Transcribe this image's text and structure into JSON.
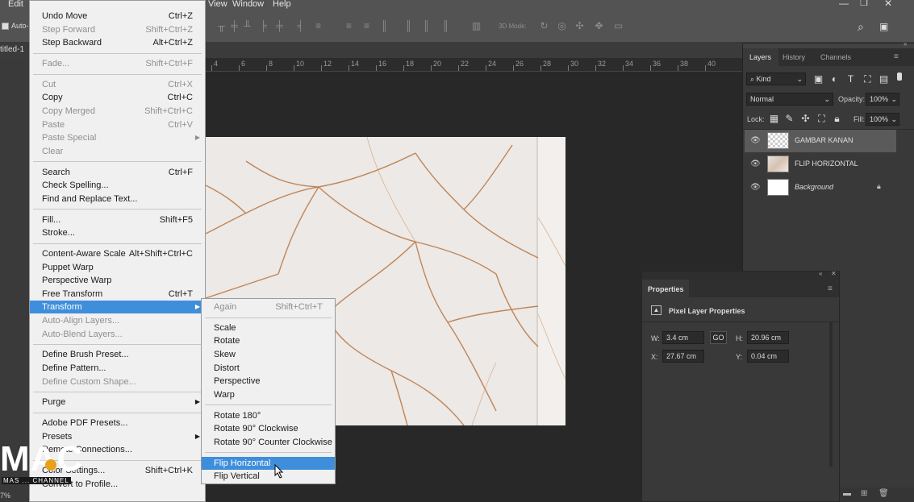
{
  "menubar": {
    "items": [
      "Edit",
      "View",
      "Window",
      "Help"
    ]
  },
  "optbar": {
    "auto_label": "Auto-",
    "mode_3d": "3D Mode:"
  },
  "doc_tab": {
    "title": "titled-1"
  },
  "ruler": {
    "ticks": [
      "4",
      "6",
      "8",
      "10",
      "12",
      "14",
      "16",
      "18",
      "20",
      "22",
      "24",
      "26",
      "28",
      "30",
      "32",
      "34",
      "36",
      "38",
      "40"
    ]
  },
  "edit_menu": {
    "items": [
      {
        "label": "Undo Move",
        "shortcut": "Ctrl+Z",
        "enabled": true
      },
      {
        "label": "Step Forward",
        "shortcut": "Shift+Ctrl+Z",
        "enabled": false
      },
      {
        "label": "Step Backward",
        "shortcut": "Alt+Ctrl+Z",
        "enabled": true
      },
      {
        "sep": true
      },
      {
        "label": "Fade...",
        "shortcut": "Shift+Ctrl+F",
        "enabled": false
      },
      {
        "sep": true
      },
      {
        "label": "Cut",
        "shortcut": "Ctrl+X",
        "enabled": false
      },
      {
        "label": "Copy",
        "shortcut": "Ctrl+C",
        "enabled": true
      },
      {
        "label": "Copy Merged",
        "shortcut": "Shift+Ctrl+C",
        "enabled": false
      },
      {
        "label": "Paste",
        "shortcut": "Ctrl+V",
        "enabled": false
      },
      {
        "label": "Paste Special",
        "shortcut": "",
        "enabled": false,
        "sub": true
      },
      {
        "label": "Clear",
        "shortcut": "",
        "enabled": false
      },
      {
        "sep": true
      },
      {
        "label": "Search",
        "shortcut": "Ctrl+F",
        "enabled": true
      },
      {
        "label": "Check Spelling...",
        "shortcut": "",
        "enabled": true
      },
      {
        "label": "Find and Replace Text...",
        "shortcut": "",
        "enabled": true
      },
      {
        "sep": true
      },
      {
        "label": "Fill...",
        "shortcut": "Shift+F5",
        "enabled": true
      },
      {
        "label": "Stroke...",
        "shortcut": "",
        "enabled": true
      },
      {
        "sep": true
      },
      {
        "label": "Content-Aware Scale",
        "shortcut": "Alt+Shift+Ctrl+C",
        "enabled": true
      },
      {
        "label": "Puppet Warp",
        "shortcut": "",
        "enabled": true
      },
      {
        "label": "Perspective Warp",
        "shortcut": "",
        "enabled": true
      },
      {
        "label": "Free Transform",
        "shortcut": "Ctrl+T",
        "enabled": true
      },
      {
        "label": "Transform",
        "shortcut": "",
        "enabled": true,
        "sub": true,
        "highlighted": true
      },
      {
        "label": "Auto-Align Layers...",
        "shortcut": "",
        "enabled": false
      },
      {
        "label": "Auto-Blend Layers...",
        "shortcut": "",
        "enabled": false
      },
      {
        "sep": true
      },
      {
        "label": "Define Brush Preset...",
        "shortcut": "",
        "enabled": true
      },
      {
        "label": "Define Pattern...",
        "shortcut": "",
        "enabled": true
      },
      {
        "label": "Define Custom Shape...",
        "shortcut": "",
        "enabled": false
      },
      {
        "sep": true
      },
      {
        "label": "Purge",
        "shortcut": "",
        "enabled": true,
        "sub": true
      },
      {
        "sep": true
      },
      {
        "label": "Adobe PDF Presets...",
        "shortcut": "",
        "enabled": true
      },
      {
        "label": "Presets",
        "shortcut": "",
        "enabled": true,
        "sub": true
      },
      {
        "label": "Remote Connections...",
        "shortcut": "",
        "enabled": true
      },
      {
        "sep": true
      },
      {
        "label": "Color Settings...",
        "shortcut": "Shift+Ctrl+K",
        "enabled": true
      },
      {
        "label": "Convert to Profile...",
        "shortcut": "",
        "enabled": true
      }
    ]
  },
  "transform_menu": {
    "items": [
      {
        "label": "Again",
        "shortcut": "Shift+Ctrl+T",
        "enabled": false
      },
      {
        "sep": true
      },
      {
        "label": "Scale",
        "enabled": true
      },
      {
        "label": "Rotate",
        "enabled": true
      },
      {
        "label": "Skew",
        "enabled": true
      },
      {
        "label": "Distort",
        "enabled": true
      },
      {
        "label": "Perspective",
        "enabled": true
      },
      {
        "label": "Warp",
        "enabled": true
      },
      {
        "sep": true
      },
      {
        "label": "Rotate 180°",
        "enabled": true
      },
      {
        "label": "Rotate 90° Clockwise",
        "enabled": true
      },
      {
        "label": "Rotate 90° Counter Clockwise",
        "enabled": true
      },
      {
        "sep": true
      },
      {
        "label": "Flip Horizontal",
        "enabled": true,
        "highlighted": true
      },
      {
        "label": "Flip Vertical",
        "enabled": true
      }
    ]
  },
  "layers_panel": {
    "tabs": [
      "Layers",
      "History",
      "Channels"
    ],
    "filter": "Kind",
    "blend_mode": "Normal",
    "opacity_label": "Opacity:",
    "opacity": "100%",
    "lock_label": "Lock:",
    "fill_label": "Fill:",
    "fill": "100%",
    "layers": [
      {
        "name": "GAMBAR KANAN",
        "selected": true,
        "italic": false
      },
      {
        "name": "FLIP HORIZONTAL",
        "selected": false,
        "italic": false
      },
      {
        "name": "Background",
        "selected": false,
        "italic": true
      }
    ]
  },
  "properties": {
    "title": "Properties",
    "subtitle": "Pixel Layer Properties",
    "w_label": "W:",
    "w": "3.4 cm",
    "h_label": "H:",
    "h": "20.96 cm",
    "x_label": "X:",
    "x": "27.67 cm",
    "y_label": "Y:",
    "y": "0.04 cm",
    "link_label": "GO"
  },
  "status": {
    "zoom": "7%"
  },
  "watermark": {
    "big": "MAC",
    "small": "MAS ... CHANNEL"
  },
  "colors": {
    "highlight": "#3e8edb",
    "menu_bg": "#f0f0f0",
    "panel_bg": "#393939"
  }
}
